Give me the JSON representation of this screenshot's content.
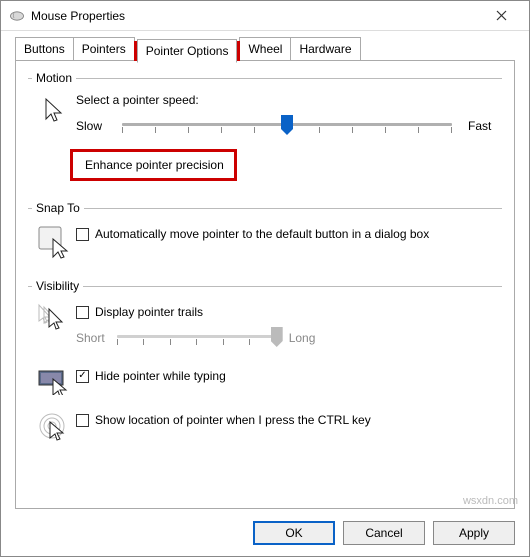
{
  "window": {
    "title": "Mouse Properties"
  },
  "tabs": {
    "buttons": "Buttons",
    "pointers": "Pointers",
    "pointer_options": "Pointer Options",
    "wheel": "Wheel",
    "hardware": "Hardware",
    "active": "pointer_options"
  },
  "motion": {
    "legend": "Motion",
    "speed_label": "Select a pointer speed:",
    "slow": "Slow",
    "fast": "Fast",
    "enhance_label": "Enhance pointer precision",
    "enhance_checked": false,
    "slider_value": 5,
    "slider_max": 10
  },
  "snap": {
    "legend": "Snap To",
    "auto_label": "Automatically move pointer to the default button in a dialog box",
    "auto_checked": false
  },
  "visibility": {
    "legend": "Visibility",
    "trails_label": "Display pointer trails",
    "trails_checked": false,
    "trails_short": "Short",
    "trails_long": "Long",
    "hide_label": "Hide pointer while typing",
    "hide_checked": true,
    "ctrl_label": "Show location of pointer when I press the CTRL key",
    "ctrl_checked": false
  },
  "buttons": {
    "ok": "OK",
    "cancel": "Cancel",
    "apply": "Apply"
  },
  "watermark": "wsxdn.com"
}
